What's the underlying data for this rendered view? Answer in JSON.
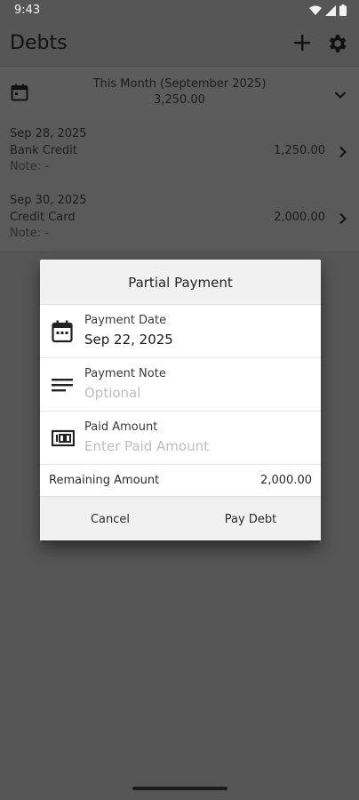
{
  "status_bar": {
    "time": "9:43",
    "icons": [
      "wifi-icon",
      "signal-icon",
      "battery-icon"
    ]
  },
  "app_bar": {
    "title": "Debts",
    "actions": [
      "add-icon",
      "gear-icon"
    ]
  },
  "period_selector": {
    "label": "This Month (September 2025)",
    "total": "3,250.00"
  },
  "debts": [
    {
      "date": "Sep 28, 2025",
      "name": "Bank Credit",
      "note": "Note: -",
      "amount": "1,250.00"
    },
    {
      "date": "Sep 30, 2025",
      "name": "Credit Card",
      "note": "Note: -",
      "amount": "2,000.00"
    }
  ],
  "dialog": {
    "title": "Partial Payment",
    "payment_date": {
      "label": "Payment Date",
      "value": "Sep 22, 2025"
    },
    "payment_note": {
      "label": "Payment Note",
      "placeholder": "Optional"
    },
    "paid_amount": {
      "label": "Paid Amount",
      "placeholder": "Enter Paid Amount"
    },
    "remaining": {
      "label": "Remaining Amount",
      "value": "2,000.00"
    },
    "cancel_label": "Cancel",
    "pay_label": "Pay Debt"
  },
  "colors": {
    "scrim": "#565656",
    "dialog_bg": "#ffffff",
    "dialog_header_bg": "#f1f1f1",
    "placeholder_text": "#bdbdbd"
  }
}
